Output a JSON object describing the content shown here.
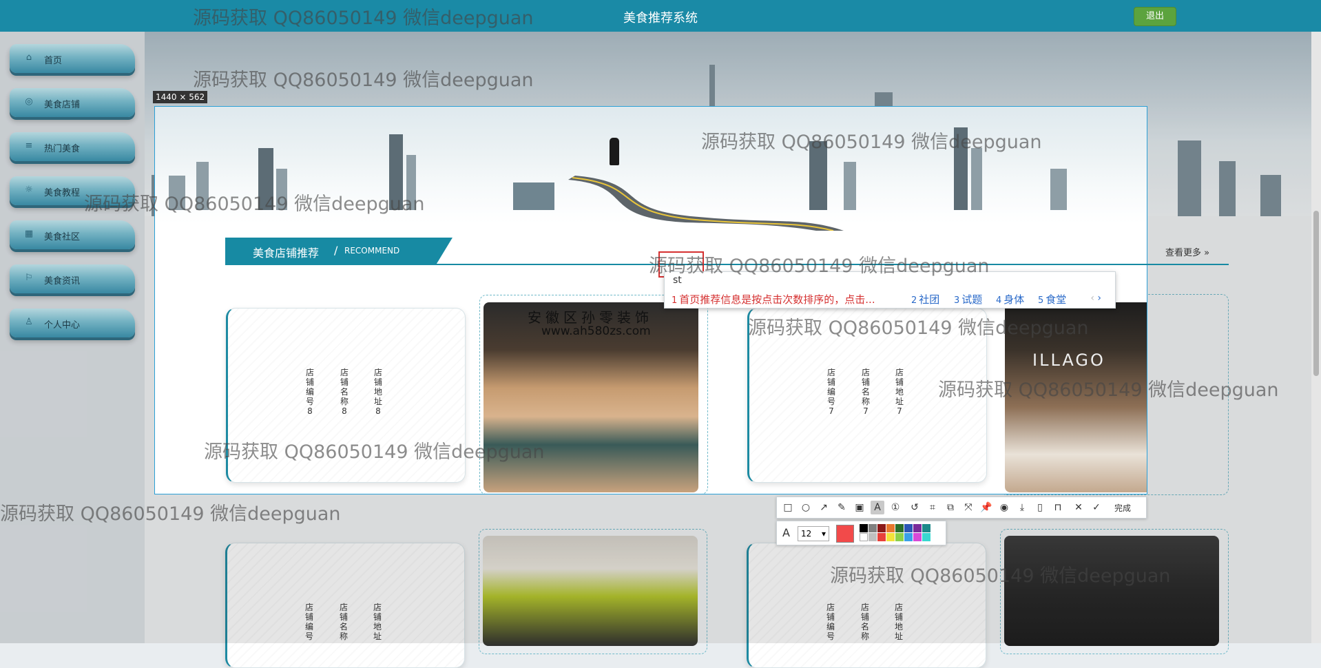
{
  "header": {
    "title": "美食推荐系统",
    "logout_label": "退出"
  },
  "sidebar": {
    "items": [
      {
        "label": "首页",
        "icon": "home-icon"
      },
      {
        "label": "美食店铺",
        "icon": "shop-icon"
      },
      {
        "label": "热门美食",
        "icon": "food-icon"
      },
      {
        "label": "美食教程",
        "icon": "tutorial-icon"
      },
      {
        "label": "美食社区",
        "icon": "community-icon"
      },
      {
        "label": "美食资讯",
        "icon": "news-icon"
      },
      {
        "label": "个人中心",
        "icon": "user-icon"
      }
    ]
  },
  "screenshot_tool": {
    "size_label": "1440 × 562",
    "finish_label": "完成",
    "font_size": "12"
  },
  "section": {
    "title": "美食店铺推荐",
    "subtitle": "RECOMMEND",
    "more_label": "查看更多"
  },
  "stores": [
    {
      "col1": "店铺编号8",
      "col2": "店铺名称8",
      "col3": "店铺地址8"
    },
    {
      "col1": "店铺编号7",
      "col2": "店铺名称7",
      "col3": "店铺地址7"
    },
    {
      "col1": "店铺编号",
      "col2": "店铺名称",
      "col3": "店铺地址"
    },
    {
      "col1": "店铺编号",
      "col2": "店铺名称",
      "col3": "店铺地址"
    }
  ],
  "photo_text": {
    "sign": "安徽区孙零装饰",
    "url": "www.ah580zs.com",
    "store2": "ILLAGO"
  },
  "ime": {
    "input": "st",
    "candidates": [
      {
        "n": "1",
        "text": "首页推荐信息是按点击次数排序的，点击..."
      },
      {
        "n": "2",
        "text": "社团"
      },
      {
        "n": "3",
        "text": "试题"
      },
      {
        "n": "4",
        "text": "身体"
      },
      {
        "n": "5",
        "text": "食堂"
      }
    ]
  },
  "watermark": "源码获取 QQ86050149 微信deepguan",
  "colors": {
    "primary": "#178aa3",
    "header": "#1a8aa6",
    "logout": "#5ca33e",
    "highlight": "#d53030"
  }
}
